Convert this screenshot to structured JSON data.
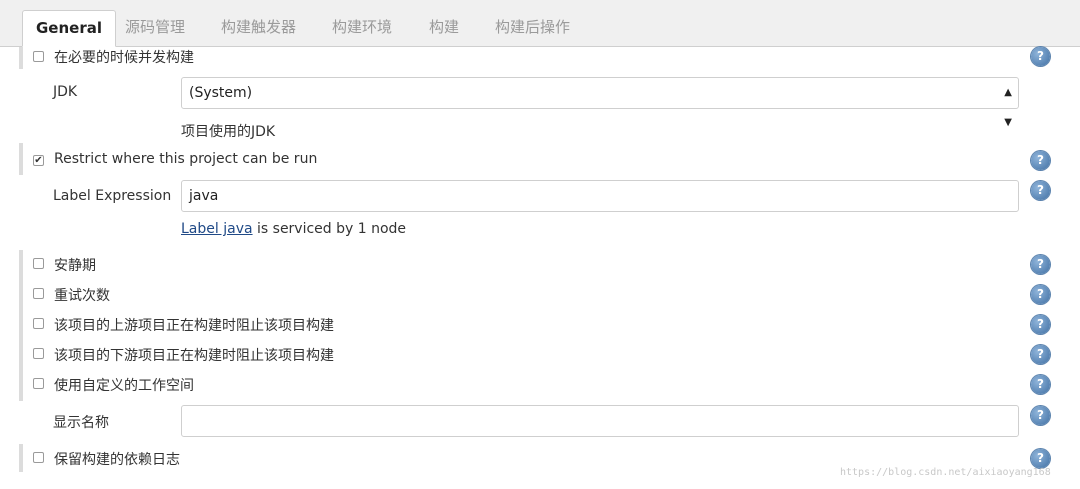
{
  "tabs": [
    {
      "label": "General",
      "active": true
    },
    {
      "label": "源码管理"
    },
    {
      "label": "构建触发器"
    },
    {
      "label": "构建环境"
    },
    {
      "label": "构建"
    },
    {
      "label": "构建后操作"
    }
  ],
  "options": {
    "concurrent_build": {
      "label": "在必要的时候并发构建",
      "checked": false
    },
    "restrict": {
      "label": "Restrict where this project can be run",
      "checked": true
    },
    "quiet_period": {
      "label": "安静期",
      "checked": false
    },
    "retry_count": {
      "label": "重试次数",
      "checked": false
    },
    "block_upstream": {
      "label": "该项目的上游项目正在构建时阻止该项目构建",
      "checked": false
    },
    "block_downstream": {
      "label": "该项目的下游项目正在构建时阻止该项目构建",
      "checked": false
    },
    "custom_workspace": {
      "label": "使用自定义的工作空间",
      "checked": false
    },
    "keep_dependencies": {
      "label": "保留构建的依赖日志",
      "checked": false
    }
  },
  "jdk": {
    "label": "JDK",
    "value": "(System)",
    "description": "项目使用的JDK"
  },
  "label_expression": {
    "label": "Label Expression",
    "value": "java",
    "link_text": "Label java",
    "status_text": " is serviced by 1 node"
  },
  "display_name": {
    "label": "显示名称",
    "value": ""
  },
  "help_glyph": "?",
  "watermark": "https://blog.csdn.net/aixiaoyang168",
  "colors": {
    "help_icon": "#3f6fa3",
    "link": "#204a87"
  }
}
